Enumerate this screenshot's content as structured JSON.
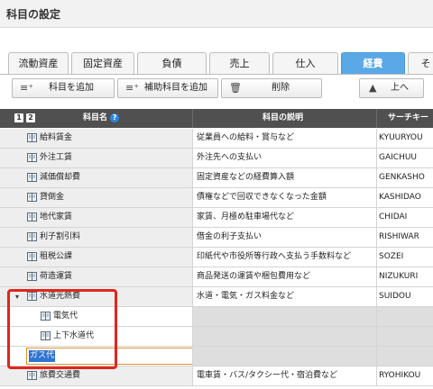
{
  "window": {
    "title": "科目の設定"
  },
  "tabs": [
    {
      "label": "流動資産",
      "active": false
    },
    {
      "label": "固定資産",
      "active": false
    },
    {
      "label": "負債",
      "active": false
    },
    {
      "label": "売上",
      "active": false
    },
    {
      "label": "仕入",
      "active": false
    },
    {
      "label": "経費",
      "active": true
    },
    {
      "label": "そ",
      "active": false
    }
  ],
  "toolbar": {
    "add_account": "科目を追加",
    "add_sub_account": "補助科目を追加",
    "delete": "削除",
    "move_up": "上へ"
  },
  "grid": {
    "level_buttons": [
      "1",
      "2"
    ],
    "columns": {
      "name": "科目名",
      "description": "科目の説明",
      "search_key": "サーチキー"
    },
    "rows": [
      {
        "name": "給料賃金",
        "description": "従業員への給料・賞与など",
        "key": "KYUURYOU"
      },
      {
        "name": "外注工賃",
        "description": "外注先への支払い",
        "key": "GAICHUU"
      },
      {
        "name": "減価償却費",
        "description": "固定資産などの経費算入額",
        "key": "GENKASHO"
      },
      {
        "name": "貸倒金",
        "description": "債権などで回収できなくなった金額",
        "key": "KASHIDAO"
      },
      {
        "name": "地代家賃",
        "description": "家賃、月極め駐車場代など",
        "key": "CHIDAI"
      },
      {
        "name": "利子割引料",
        "description": "借金の利子支払い",
        "key": "RISHIWAR"
      },
      {
        "name": "租税公課",
        "description": "印紙代や市役所等行政へ支払う手数料など",
        "key": "SOZEI"
      },
      {
        "name": "荷造運賃",
        "description": "商品発送の運賃や梱包費用など",
        "key": "NIZUKURI"
      },
      {
        "name": "水道光熱費",
        "description": "水道・電気・ガス料金など",
        "key": "SUIDOU",
        "expanded": true
      },
      {
        "name": "電気代",
        "description": "",
        "key": "",
        "sub": true
      },
      {
        "name": "上下水道代",
        "description": "",
        "key": "",
        "sub": true
      },
      {
        "name": "ガス代",
        "description": "",
        "key": "",
        "editing": true
      },
      {
        "name": "旅費交通費",
        "description": "電車賃・バス/タクシー代・宿泊費など",
        "key": "RYOHIKOU"
      }
    ]
  }
}
